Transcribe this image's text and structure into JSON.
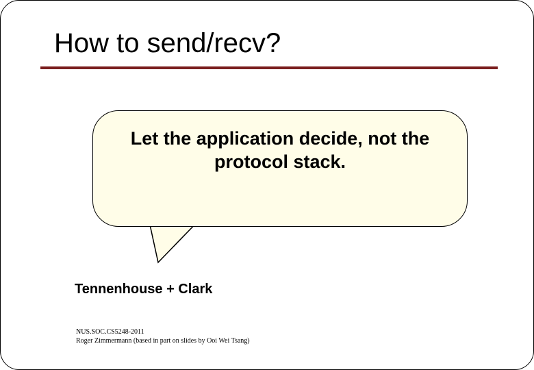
{
  "slide": {
    "title": "How to send/recv?",
    "bubble_text": "Let the application decide, not the protocol stack.",
    "attribution": "Tennenhouse + Clark",
    "footer_line1": "NUS.SOC.CS5248-2011",
    "footer_line2": "Roger Zimmermann (based in part on slides by Ooi Wei Tsang)"
  }
}
